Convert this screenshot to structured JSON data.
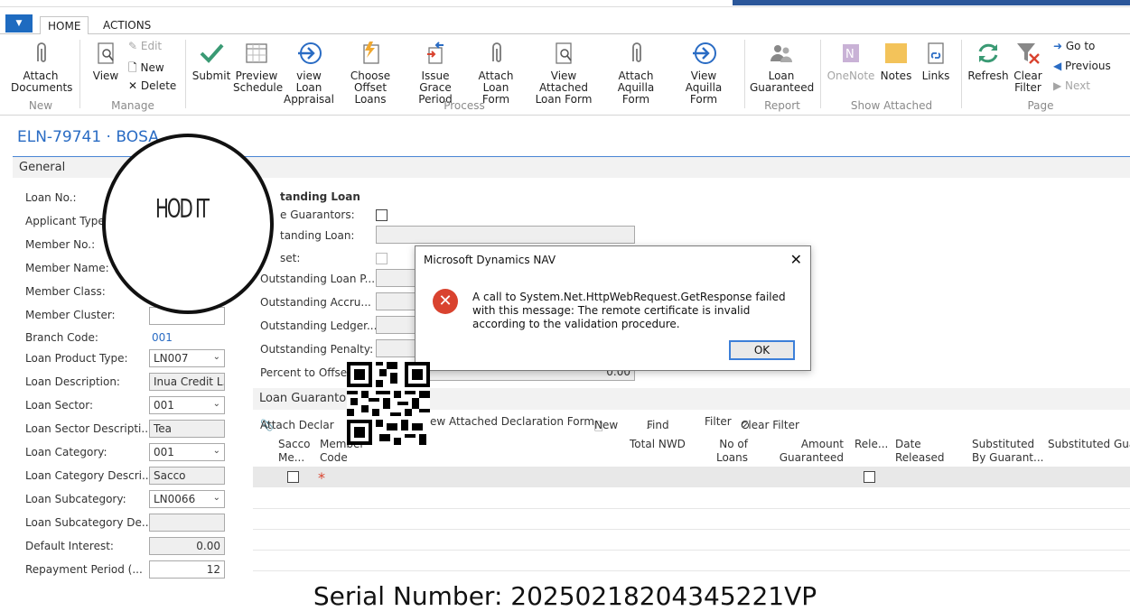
{
  "tabs": {
    "home": "HOME",
    "actions": "ACTIONS"
  },
  "ribbon": {
    "attach_documents": "Attach\nDocuments",
    "view": "View",
    "edit": "Edit",
    "new": "New",
    "delete": "Delete",
    "submit": "Submit",
    "preview_schedule": "Preview\nSchedule",
    "view_loan_appraisal": "view Loan\nAppraisal",
    "choose_offset_loans": "Choose\nOffset Loans",
    "issue_grace_period": "Issue Grace\nPeriod",
    "attach_loan_form": "Attach\nLoan Form",
    "view_attached_loan_form": "View Attached\nLoan Form",
    "attach_aquilla_form": "Attach\nAquilla Form",
    "view_aquilla_form": "View\nAquilla Form",
    "loan_guaranteed": "Loan\nGuaranteed",
    "onenote": "OneNote",
    "notes": "Notes",
    "links": "Links",
    "refresh": "Refresh",
    "clear_filter": "Clear\nFilter",
    "go_to": "Go to",
    "previous": "Previous",
    "next": "Next",
    "groups": {
      "new": "New",
      "manage": "Manage",
      "process": "Process",
      "report": "Report",
      "show_attached": "Show Attached",
      "page": "Page"
    }
  },
  "page_title": "ELN-79741 · BOSA",
  "general_tab": "General",
  "stamp_text": "HOD IT",
  "fields": {
    "loan_no": "Loan  No.:",
    "applicant_type": "Applicant Type:",
    "member_no": "Member No.:",
    "member_name": "Member Name:",
    "member_class": "Member Class:",
    "member_cluster": "Member Cluster:",
    "branch_code": "Branch Code:",
    "branch_code_val": "001",
    "loan_product_type": "Loan Product Type:",
    "loan_product_type_val": "LN007",
    "loan_description": "Loan Description:",
    "loan_description_val": "Inua Credit L...",
    "loan_sector": "Loan Sector:",
    "loan_sector_val": "001",
    "loan_sector_desc": "Loan Sector Descripti...",
    "loan_sector_desc_val": "Tea",
    "loan_category": "Loan Category:",
    "loan_category_val": "001",
    "loan_category_desc": "Loan Category Descri...",
    "loan_category_desc_val": "Sacco",
    "loan_subcategory": "Loan Subcategory:",
    "loan_subcategory_val": "LN0066",
    "loan_subcategory_desc": "Loan Subcategory De...",
    "default_interest": "Default Interest:",
    "default_interest_val": "0.00",
    "repayment_period": "Repayment Period (...",
    "repayment_period_val": "12"
  },
  "right_fields": {
    "section": "tanding Loan",
    "guarantors": "e Guarantors:",
    "outstanding_loan": "tanding Loan:",
    "offset": "set:",
    "outstanding_loan_p": "Outstanding Loan P...",
    "outstanding_accru": "Outstanding Accru...",
    "outstanding_ledger": "Outstanding Ledger...",
    "outstanding_penalty": "Outstanding Penalty:",
    "percent_to_offset": "Percent to Offset:",
    "percent_to_offset_val": "0.00"
  },
  "guarantors": {
    "header": "Loan Guaranto",
    "attach_declaration": "Attach Declar",
    "view_attached_declaration": "ew Attached Declaration Form",
    "new": "New",
    "find": "Find",
    "filter": "Filter",
    "clear_filter": "Clear Filter",
    "columns": {
      "sacco_member": "Sacco\nMe...",
      "member_code": "Member\nCode",
      "total_nwd": "Total NWD",
      "no_of_loans": "No of\nLoans Gu...",
      "amount_guaranteed": "Amount\nGuaranteed",
      "released": "Rele...",
      "date_released": "Date\nReleased",
      "substituted_by": "Substituted\nBy Guarant...",
      "substituted_guara": "Substituted Guara"
    },
    "required_mark": "*"
  },
  "dialog": {
    "title": "Microsoft Dynamics NAV",
    "message": "A call to System.Net.HttpWebRequest.GetResponse failed with this message: The remote certificate is invalid according to the validation procedure.",
    "ok": "OK"
  },
  "serial": "Serial Number: 20250218204345221VP",
  "colors": {
    "accent": "#2a6cc4",
    "error": "#d9432f",
    "menu": "#1e6bc0"
  }
}
